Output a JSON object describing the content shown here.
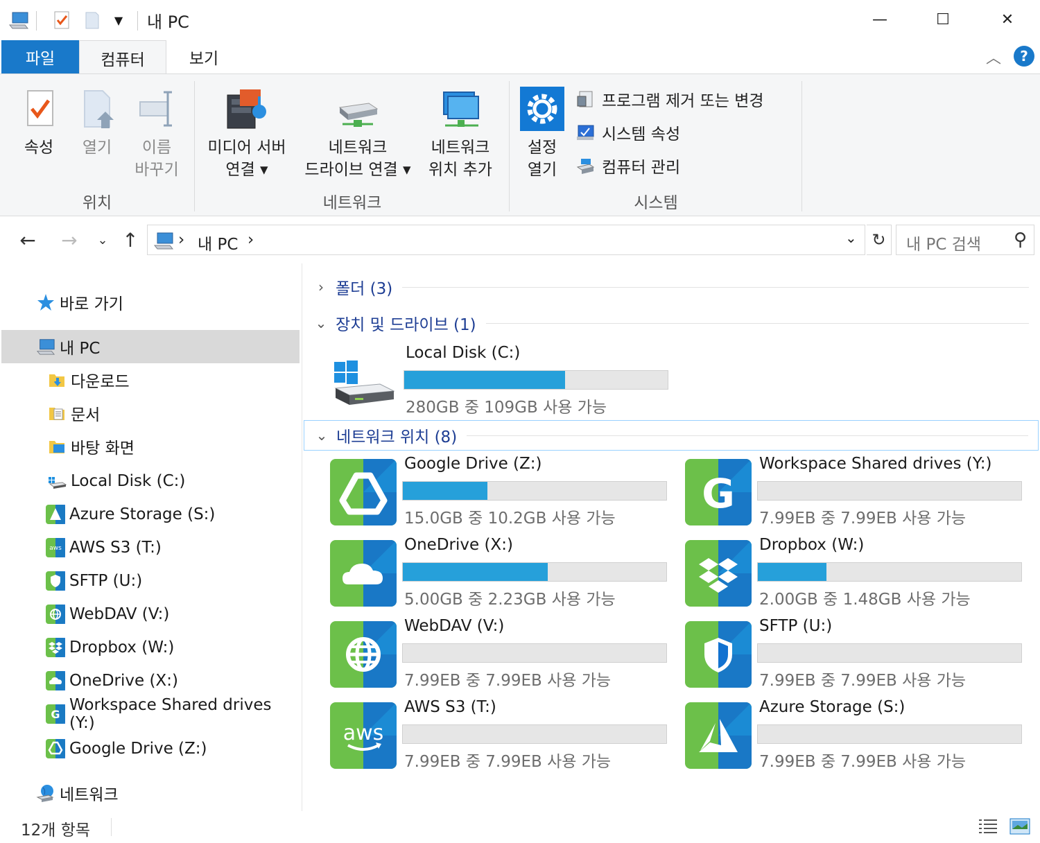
{
  "window": {
    "title": "내 PC",
    "minimize": "—",
    "maximize": "☐",
    "close": "✕"
  },
  "tabs": {
    "file": "파일",
    "computer": "컴퓨터",
    "view": "보기"
  },
  "ribbon": {
    "location": {
      "label": "위치",
      "properties": "속성",
      "open": "열기",
      "rename_l1": "이름",
      "rename_l2": "바꾸기"
    },
    "network": {
      "label": "네트워크",
      "media_l1": "미디어 서버",
      "media_l2": "연결 ▾",
      "mapdrive_l1": "네트워크",
      "mapdrive_l2": "드라이브 연결 ▾",
      "addloc_l1": "네트워크",
      "addloc_l2": "위치 추가"
    },
    "system": {
      "label": "시스템",
      "settings_l1": "설정",
      "settings_l2": "열기",
      "uninstall": "프로그램 제거 또는 변경",
      "sysprops": "시스템 속성",
      "manage": "컴퓨터 관리"
    }
  },
  "address": {
    "crumb_sep": "›",
    "crumb": "내 PC",
    "search_placeholder": "내 PC 검색"
  },
  "nav": {
    "quick_access": "바로 가기",
    "this_pc": "내 PC",
    "items": [
      "다운로드",
      "문서",
      "바탕 화면",
      "Local Disk (C:)",
      "Azure Storage (S:)",
      "AWS S3 (T:)",
      "SFTP (U:)",
      "WebDAV (V:)",
      "Dropbox (W:)",
      "OneDrive (X:)",
      "Workspace Shared drives (Y:)",
      "Google Drive (Z:)"
    ],
    "network": "네트워크"
  },
  "groups": {
    "folders": "폴더 (3)",
    "devices": "장치 및 드라이브 (1)",
    "network_locations": "네트워크 위치 (8)"
  },
  "local_disk": {
    "name": "Local Disk (C:)",
    "info": "280GB 중 109GB 사용 가능",
    "used_fraction": 0.61
  },
  "network_drives": [
    {
      "name": "Google Drive (Z:)",
      "info": "15.0GB 중 10.2GB 사용 가능",
      "used_fraction": 0.32,
      "icon": "google-drive-icon"
    },
    {
      "name": "Workspace Shared drives (Y:)",
      "info": "7.99EB 중 7.99EB 사용 가능",
      "used_fraction": 0.0,
      "icon": "google-workspace-icon"
    },
    {
      "name": "OneDrive (X:)",
      "info": "5.00GB 중 2.23GB 사용 가능",
      "used_fraction": 0.55,
      "icon": "onedrive-icon"
    },
    {
      "name": "Dropbox (W:)",
      "info": "2.00GB 중 1.48GB 사용 가능",
      "used_fraction": 0.26,
      "icon": "dropbox-icon"
    },
    {
      "name": "WebDAV (V:)",
      "info": "7.99EB 중 7.99EB 사용 가능",
      "used_fraction": 0.0,
      "icon": "webdav-globe-icon"
    },
    {
      "name": "SFTP (U:)",
      "info": "7.99EB 중 7.99EB 사용 가능",
      "used_fraction": 0.0,
      "icon": "sftp-shield-icon"
    },
    {
      "name": "AWS S3 (T:)",
      "info": "7.99EB 중 7.99EB 사용 가능",
      "used_fraction": 0.0,
      "icon": "aws-icon"
    },
    {
      "name": "Azure Storage (S:)",
      "info": "7.99EB 중 7.99EB 사용 가능",
      "used_fraction": 0.0,
      "icon": "azure-icon"
    }
  ],
  "status": {
    "count": "12개 항목"
  },
  "colors": {
    "accent": "#1979ca",
    "bar_fill": "#26a0da",
    "tile_green": "#6cc04a",
    "tile_blue": "#1272d0"
  }
}
